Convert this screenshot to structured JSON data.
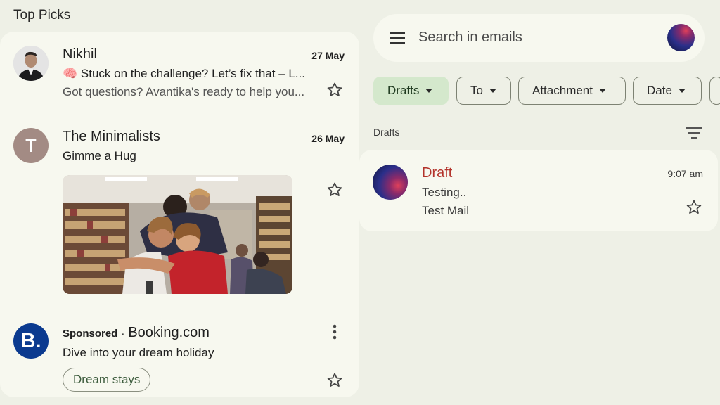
{
  "top_picks": {
    "title": "Top Picks",
    "items": [
      {
        "sender": "Nikhil",
        "date": "27 May",
        "subject": "🧠 Stuck on the challenge? Let’s fix that – L...",
        "snippet": "Got questions? Avantika's ready to help you..."
      },
      {
        "sender": "The Minimalists",
        "avatar_letter": "T",
        "date": "26 May",
        "subject": "Gimme a Hug"
      },
      {
        "sponsored": "Sponsored",
        "separator": "·",
        "brand": "Booking.com",
        "avatar_letter": "B.",
        "subject": "Dive into your dream holiday",
        "cta": "Dream stays"
      }
    ]
  },
  "search": {
    "placeholder": "Search in emails"
  },
  "filters": [
    {
      "label": "Drafts"
    },
    {
      "label": "To"
    },
    {
      "label": "Attachment"
    },
    {
      "label": "Date"
    }
  ],
  "list": {
    "label": "Drafts",
    "items": [
      {
        "label": "Draft",
        "time": "9:07 am",
        "subject": "Testing..",
        "snippet": "Test Mail"
      }
    ]
  },
  "colors": {
    "background": "#eef0e6",
    "card": "#f7f8ef",
    "active_chip": "#d4e8cc",
    "draft_red": "#b3332b",
    "booking_blue": "#0b3a8f"
  }
}
